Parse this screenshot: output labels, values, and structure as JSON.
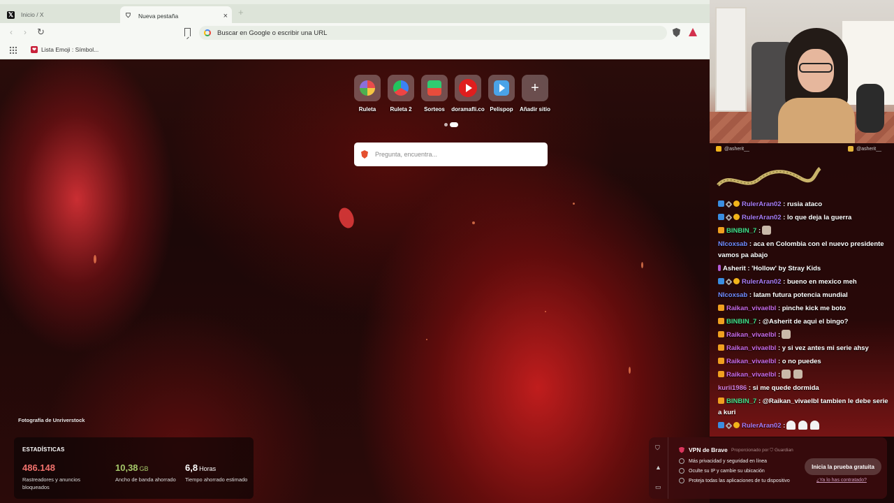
{
  "browser": {
    "tabs": [
      {
        "title": "Inicio / X",
        "active": false
      },
      {
        "title": "Nueva pestaña",
        "active": true
      }
    ],
    "address_placeholder": "Buscar en Google o escribir una URL",
    "bookmarks": [
      {
        "label": "Lista Emoji : Símbol..."
      }
    ]
  },
  "ntp": {
    "shortcuts": [
      {
        "label": "Ruleta",
        "icon": "roulette-icon"
      },
      {
        "label": "Ruleta 2",
        "icon": "roulette-icon"
      },
      {
        "label": "Sorteos",
        "icon": "sorteos-icon"
      },
      {
        "label": "doramafli.co",
        "icon": "youtube-play-icon"
      },
      {
        "label": "Pelispop",
        "icon": "play-icon"
      },
      {
        "label": "Añadir sitio",
        "icon": "plus-icon"
      }
    ],
    "search_placeholder": "Pregunta, encuentra...",
    "photo_credit": "Fotografía de Unriverstock",
    "stats": {
      "title": "ESTADÍSTICAS",
      "items": [
        {
          "value": "486.148",
          "unit": "",
          "desc": "Rastreadores y anuncios bloqueados",
          "color": "#f0716c"
        },
        {
          "value": "10,38",
          "unit": "GB",
          "desc": "Ancho de banda ahorrado",
          "color": "#a6c96a"
        },
        {
          "value": "6,8",
          "unit": "Horas",
          "desc": "Tiempo ahorrado estimado",
          "color": "#ffffff"
        }
      ]
    }
  },
  "vpn": {
    "title": "VPN de Brave",
    "powered_by": "Proporcionado por ⛉ Guardian",
    "features": [
      "Más privacidad y seguridad en línea",
      "Oculte su IP y cambie su ubicación",
      "Proteja todas las aplicaciones de tu dispositivo"
    ],
    "cta": "Inicia la prueba gratuita",
    "link": "¿Ya lo has contratado?"
  },
  "stream": {
    "handle_left": "@asherit__",
    "handle_right": "@asherit__",
    "chat": [
      {
        "user": "RulerAran02",
        "color": "#a67cf5",
        "badges": [
          "b-blue",
          "b-dia",
          "b-gold"
        ],
        "text": ": rusia ataco"
      },
      {
        "user": "RulerAran02",
        "color": "#a67cf5",
        "badges": [
          "b-blue",
          "b-dia",
          "b-gold"
        ],
        "text": ": lo que deja la guerra"
      },
      {
        "user": "BINBIN_7",
        "color": "#3ee08a",
        "badges": [
          "b-sub"
        ],
        "text": ":",
        "emotes": 1
      },
      {
        "user": "NIcoxsab",
        "color": "#6f8cff",
        "badges": [],
        "text": ": aca en Colombia con el nuevo presidente vamos pa abajo"
      },
      {
        "user": "Asherit",
        "color": "#ffffff",
        "badges": [
          "b-purple"
        ],
        "text": ": 'Hollow' by Stray Kids"
      },
      {
        "user": "RulerAran02",
        "color": "#a67cf5",
        "badges": [
          "b-blue",
          "b-dia",
          "b-gold"
        ],
        "text": ": bueno en mexico meh"
      },
      {
        "user": "NIcoxsab",
        "color": "#6f8cff",
        "badges": [],
        "text": ": latam futura potencia mundial"
      },
      {
        "user": "Raikan_vivaelbl",
        "color": "#c56ae8",
        "badges": [
          "b-sub"
        ],
        "text": ": pinche kick me boto"
      },
      {
        "user": "BINBIN_7",
        "color": "#3ee08a",
        "badges": [
          "b-sub"
        ],
        "text": ": @Asherit de aqui el bingo?"
      },
      {
        "user": "Raikan_vivaelbl",
        "color": "#c56ae8",
        "badges": [
          "b-sub"
        ],
        "text": ":",
        "emotes": 1
      },
      {
        "user": "Raikan_vivaelbl",
        "color": "#c56ae8",
        "badges": [
          "b-sub"
        ],
        "text": ": y si vez antes mi serie ahsy"
      },
      {
        "user": "Raikan_vivaelbl",
        "color": "#c56ae8",
        "badges": [
          "b-sub"
        ],
        "text": ": o no puedes"
      },
      {
        "user": "Raikan_vivaelbl",
        "color": "#c56ae8",
        "badges": [
          "b-sub"
        ],
        "text": ":",
        "emotes": 2
      },
      {
        "user": "kurii1986",
        "color": "#d27fdf",
        "badges": [],
        "text": ": si me quede dormida"
      },
      {
        "user": "BINBIN_7",
        "color": "#3ee08a",
        "badges": [
          "b-sub"
        ],
        "text": ": @Raikan_vivaelbl tambien le debe serie a kuri"
      },
      {
        "user": "RulerAran02",
        "color": "#a67cf5",
        "badges": [
          "b-blue",
          "b-dia",
          "b-gold"
        ],
        "text": ":",
        "emotes": 3,
        "ghost": true
      }
    ]
  }
}
